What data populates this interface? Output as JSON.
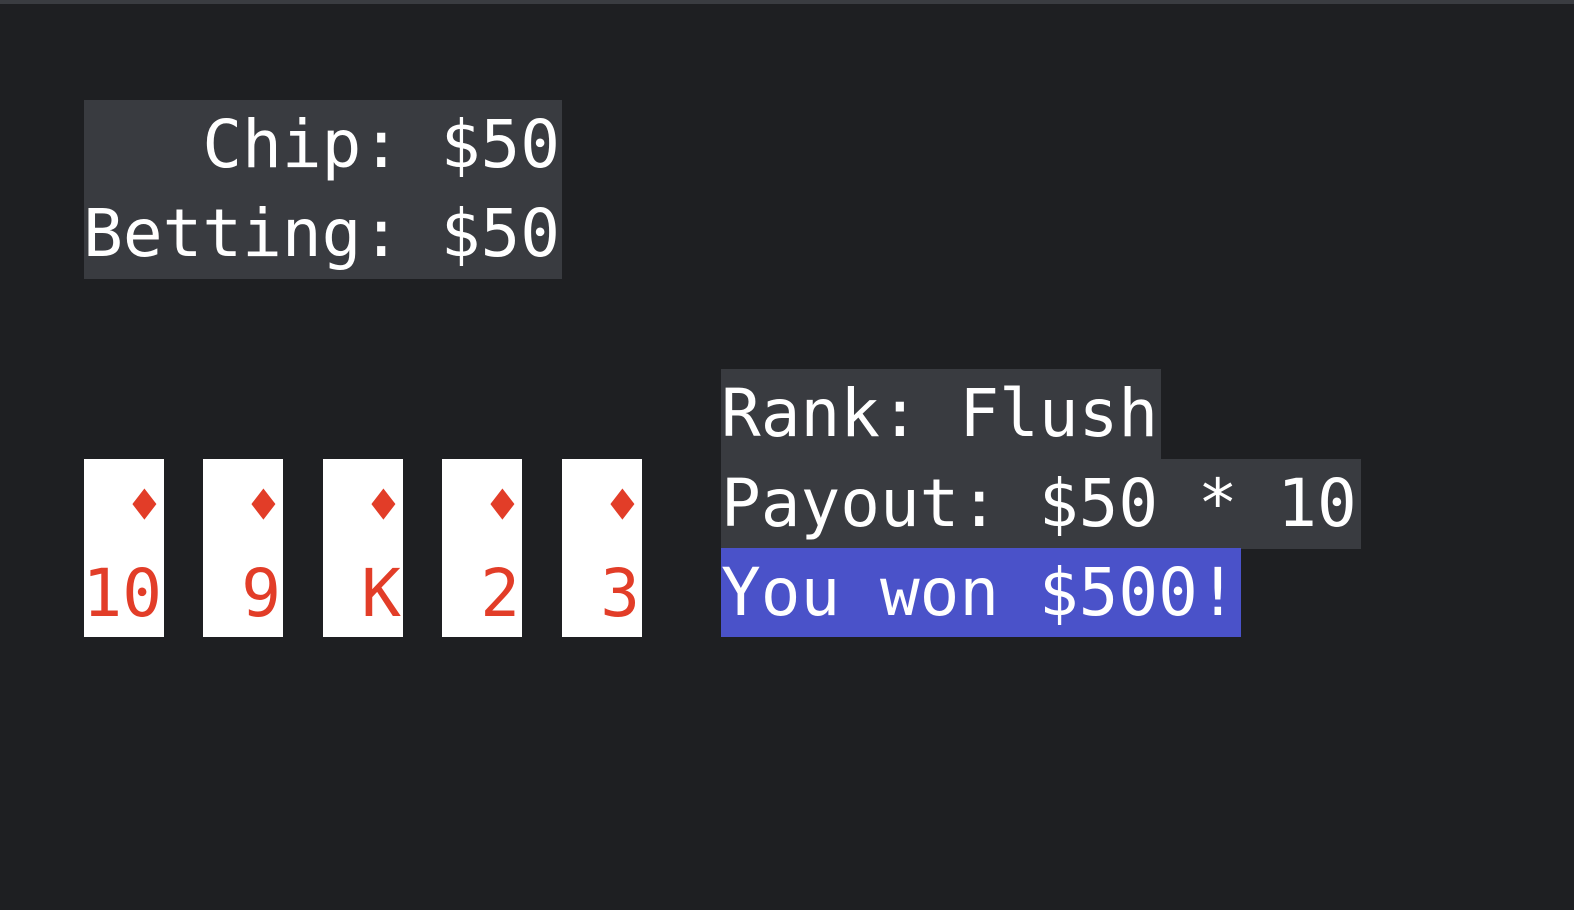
{
  "status": {
    "chip_label": "Chip: $50",
    "betting_label": "Betting: $50"
  },
  "cards": [
    {
      "rank": "10",
      "suit_icon": "♦",
      "suit": "diamonds"
    },
    {
      "rank": "9",
      "suit_icon": "♦",
      "suit": "diamonds"
    },
    {
      "rank": "K",
      "suit_icon": "♦",
      "suit": "diamonds"
    },
    {
      "rank": "2",
      "suit_icon": "♦",
      "suit": "diamonds"
    },
    {
      "rank": "3",
      "suit_icon": "♦",
      "suit": "diamonds"
    }
  ],
  "result": {
    "rank_text": "Rank: Flush",
    "payout_text": "Payout: $50 * 10",
    "won_text": "You won $500!"
  },
  "colors": {
    "background": "#1e1f22",
    "panel": "#393b40",
    "highlight": "#4a52c9",
    "card_face": "#ffffff",
    "card_red": "#e23d28"
  }
}
